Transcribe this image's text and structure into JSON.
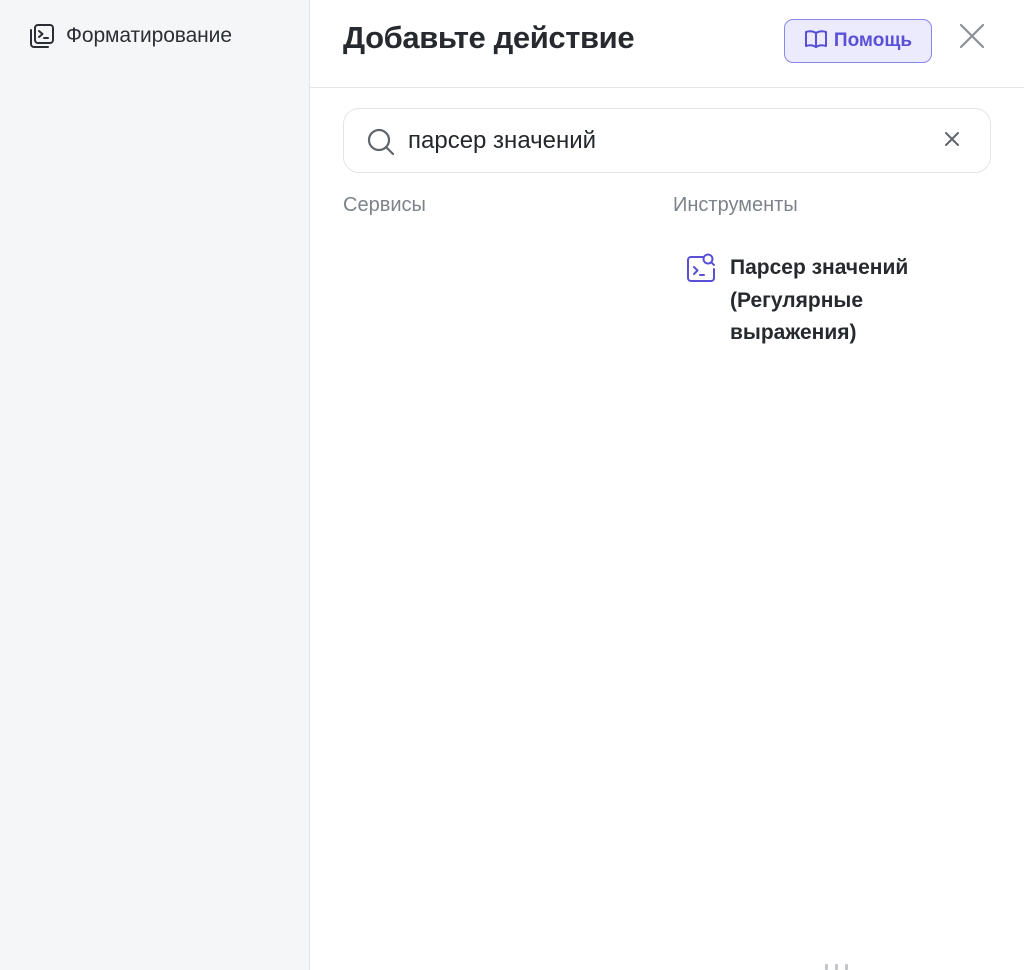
{
  "sidebar": {
    "items": [
      {
        "label": "Форматирование",
        "icon": "terminal-square-icon"
      }
    ]
  },
  "header": {
    "title": "Добавьте действие",
    "help_label": "Помощь",
    "help_icon": "book-open-icon",
    "close_icon": "close-icon"
  },
  "search": {
    "value": "парсер значений",
    "icon": "search-icon",
    "clear_icon": "clear-icon"
  },
  "sections": {
    "services": {
      "heading": "Сервисы",
      "items": []
    },
    "tools": {
      "heading": "Инструменты",
      "items": [
        {
          "label": "Парсер значений (Регулярные выражения)",
          "icon": "terminal-search-icon"
        }
      ]
    }
  },
  "colors": {
    "accent": "#5a50d6",
    "accent_border": "#8a85e8",
    "accent_background": "#ecebfd",
    "sidebar_background": "#f5f6f8",
    "muted_text": "#7d838b"
  }
}
